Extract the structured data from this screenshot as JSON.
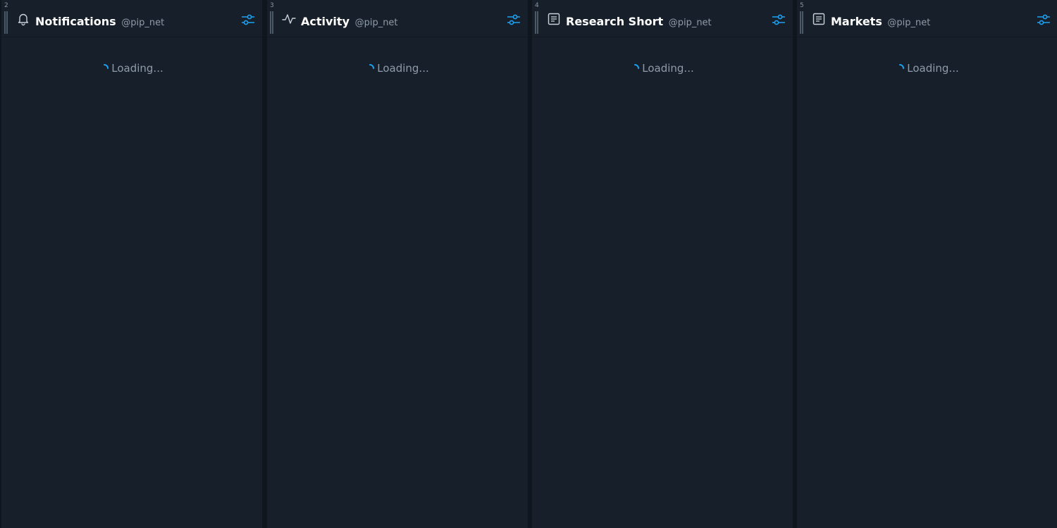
{
  "colors": {
    "accent": "#1da1f2",
    "column_bg": "#17202a",
    "deck_bg": "#0f161e"
  },
  "columns": [
    {
      "index": "2",
      "icon": "bell-icon",
      "title": "Notifications",
      "handle": "@pip_net",
      "status": "Loading..."
    },
    {
      "index": "3",
      "icon": "activity-icon",
      "title": "Activity",
      "handle": "@pip_net",
      "status": "Loading..."
    },
    {
      "index": "4",
      "icon": "document-icon",
      "title": "Research Short",
      "handle": "@pip_net",
      "status": "Loading..."
    },
    {
      "index": "5",
      "icon": "document-icon",
      "title": "Markets",
      "handle": "@pip_net",
      "status": "Loading..."
    }
  ]
}
